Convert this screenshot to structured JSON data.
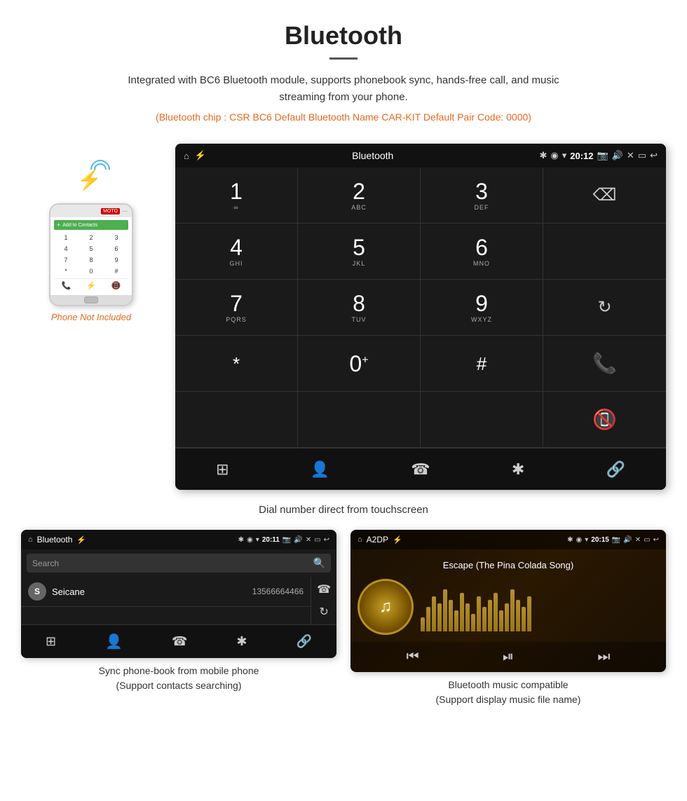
{
  "header": {
    "title": "Bluetooth",
    "description": "Integrated with BC6 Bluetooth module, supports phonebook sync, hands-free call, and music streaming from your phone.",
    "specs": "(Bluetooth chip : CSR BC6    Default Bluetooth Name CAR-KIT    Default Pair Code: 0000)"
  },
  "dial_screen": {
    "status_bar": {
      "title": "Bluetooth",
      "time": "20:12",
      "icons": [
        "⌂",
        "⚡",
        "✱",
        "◉",
        "▾"
      ]
    },
    "dialpad": [
      {
        "digit": "1",
        "sub": "∞"
      },
      {
        "digit": "2",
        "sub": "ABC"
      },
      {
        "digit": "3",
        "sub": "DEF"
      },
      {
        "digit": "",
        "sub": "",
        "special": "delete"
      },
      {
        "digit": "4",
        "sub": "GHI"
      },
      {
        "digit": "5",
        "sub": "JKL"
      },
      {
        "digit": "6",
        "sub": "MNO"
      },
      {
        "digit": "",
        "sub": "",
        "special": "empty"
      },
      {
        "digit": "7",
        "sub": "PQRS"
      },
      {
        "digit": "8",
        "sub": "TUV"
      },
      {
        "digit": "9",
        "sub": "WXYZ"
      },
      {
        "digit": "",
        "sub": "",
        "special": "reload"
      },
      {
        "digit": "*",
        "sub": ""
      },
      {
        "digit": "0",
        "sub": "+"
      },
      {
        "digit": "#",
        "sub": ""
      },
      {
        "digit": "",
        "sub": "",
        "special": "call"
      },
      {
        "digit": "",
        "sub": "",
        "special": "endcall"
      }
    ],
    "bottom_nav": [
      "⊞",
      "👤",
      "☎",
      "✱",
      "🔗"
    ]
  },
  "caption": "Dial number direct from touchscreen",
  "phonebook_screen": {
    "title": "Bluetooth",
    "search_placeholder": "Search",
    "contact": {
      "initial": "S",
      "name": "Seicane",
      "number": "13566664466"
    },
    "bottom_nav": [
      "⊞",
      "👤",
      "☎",
      "✱",
      "🔗"
    ]
  },
  "music_screen": {
    "title": "A2DP",
    "time": "20:15",
    "song_title": "Escape (The Pina Colada Song)",
    "eq_heights": [
      20,
      35,
      50,
      40,
      60,
      45,
      30,
      55,
      40,
      25,
      50,
      35,
      45,
      55,
      30,
      40,
      60,
      45,
      35,
      50
    ]
  },
  "phone_not_included": "Phone Not Included",
  "panel_captions": {
    "phonebook": "Sync phone-book from mobile phone\n(Support contacts searching)",
    "music": "Bluetooth music compatible\n(Support display music file name)"
  }
}
